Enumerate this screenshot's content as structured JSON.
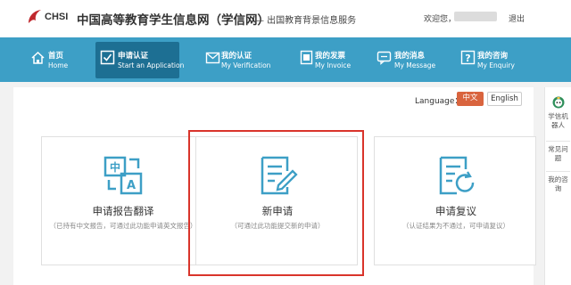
{
  "header": {
    "logo_text": "CHSI",
    "site_title": "中国高等教育学生信息网（学信网）",
    "site_subtitle": "— 出国教育背景信息服务",
    "welcome": "欢迎您，",
    "logout": "退出"
  },
  "nav": {
    "items": [
      {
        "cn": "首页",
        "en": "Home",
        "icon": "home-icon"
      },
      {
        "cn": "申请认证",
        "en": "Start an Application",
        "icon": "checkbox-icon",
        "active": true
      },
      {
        "cn": "我的认证",
        "en": "My Verification",
        "icon": "mail-icon"
      },
      {
        "cn": "我的发票",
        "en": "My Invoice",
        "icon": "invoice-icon"
      },
      {
        "cn": "我的消息",
        "en": "My Message",
        "icon": "message-icon"
      },
      {
        "cn": "我的咨询",
        "en": "My Enquiry",
        "icon": "question-icon"
      }
    ]
  },
  "language": {
    "label": "Language：",
    "options": [
      "中文",
      "English"
    ],
    "selected": "中文"
  },
  "cards": [
    {
      "title": "申请报告翻译",
      "desc": "（已持有中文报告，可通过此功能申请英文报告）",
      "icon": "translate-icon"
    },
    {
      "title": "新申请",
      "desc": "（可通过此功能提交新的申请）",
      "icon": "edit-document-icon"
    },
    {
      "title": "申请复议",
      "desc": "（认证结果为不通过，可申请复议）",
      "icon": "refresh-document-icon"
    }
  ],
  "sidebar": {
    "robot": "学信机器人",
    "faq": "常见问题",
    "consult": "我的咨询"
  },
  "colors": {
    "nav_bg": "#3d9fc6",
    "nav_active": "#1d6f93",
    "accent": "#d9643e",
    "icon": "#3d9fc6",
    "highlight": "#d9342b"
  }
}
